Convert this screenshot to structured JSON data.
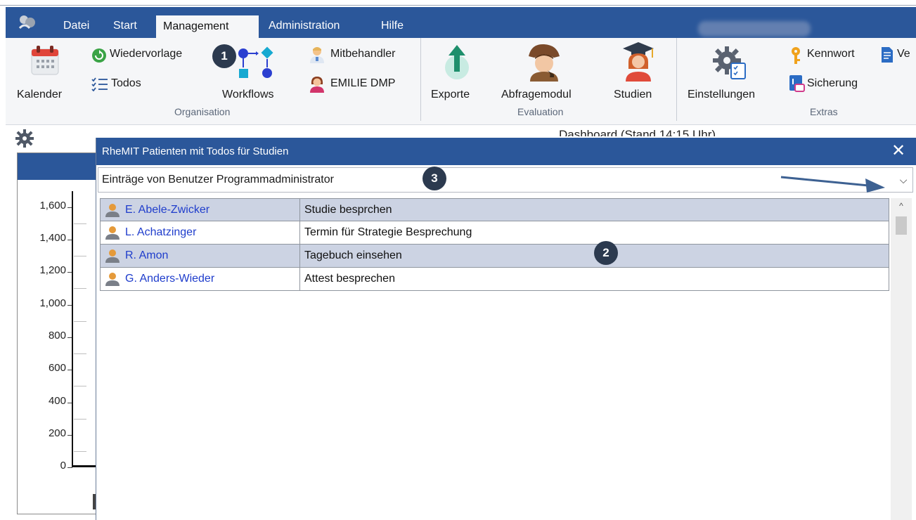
{
  "menubar": {
    "items": [
      "Datei",
      "Start",
      "Management",
      "Administration",
      "Hilfe"
    ],
    "active": "Management"
  },
  "ribbon": {
    "kalender": "Kalender",
    "wiedervorlage": "Wiedervorlage",
    "todos": "Todos",
    "workflows": "Workflows",
    "mitbehandler": "Mitbehandler",
    "emilie": "EMILIE DMP",
    "exporte": "Exporte",
    "abfragemodul": "Abfragemodul",
    "studien": "Studien",
    "einstellungen": "Einstellungen",
    "kennwort": "Kennwort",
    "sicherung": "Sicherung",
    "ve": "Ve",
    "groups": {
      "organisation": "Organisation",
      "evaluation": "Evaluation",
      "extras": "Extras"
    }
  },
  "badges": [
    "1",
    "2",
    "3"
  ],
  "dashboard": {
    "title": "Dashboard (Stand 14:15 Uhr)",
    "yticks": [
      "1,600",
      "1,400",
      "1,200",
      "1,000",
      "800",
      "600",
      "400",
      "200",
      "0"
    ]
  },
  "popup": {
    "title": "RheMIT Patienten mit Todos für Studien",
    "close_label": "✕",
    "filter_value": "Einträge von Benutzer Programmadministrator",
    "dropdown_arrow": "⌵",
    "rows": [
      {
        "patient": "E. Abele-Zwicker",
        "task": "Studie besprchen"
      },
      {
        "patient": "L. Achatzinger",
        "task": "Termin für Strategie Besprechung"
      },
      {
        "patient": "R. Amon",
        "task": "Tagebuch einsehen"
      },
      {
        "patient": "G. Anders-Wieder",
        "task": "Attest besprechen"
      }
    ],
    "scroll_up": "^"
  },
  "colors": {
    "accent": "#2b579a",
    "row_alt": "#ccd3e3",
    "link": "#1f3dcc",
    "badge": "#2c3a4f"
  }
}
